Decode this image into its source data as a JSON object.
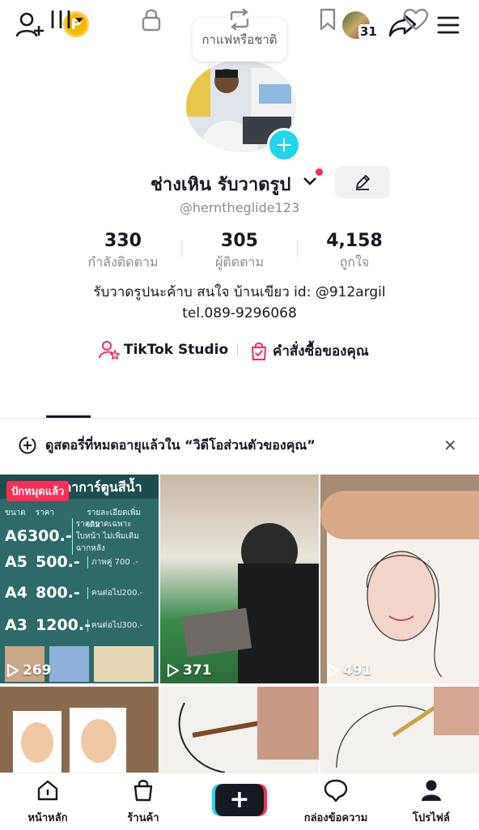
{
  "top_bar": {
    "coin_letter": "P",
    "notification_count": "31"
  },
  "tooltip": "กาแฟหรือชาติ",
  "profile": {
    "display_name": "ช่างเหิน รับวาดรูป",
    "username": "@herntheglide123",
    "stats": [
      {
        "value": "330",
        "label": "กำลังติดตาม"
      },
      {
        "value": "305",
        "label": "ผู้ติดตาม"
      },
      {
        "value": "4,158",
        "label": "ถูกใจ"
      }
    ],
    "bio_line1": "รับวาดรูปนะค้าบ สนใจ บ้านเขียว id: @912argil",
    "bio_line2": "tel.089-9296068",
    "link_studio": "TikTok Studio",
    "link_orders": "คำสั่งซื้อของคุณ"
  },
  "banner": {
    "text": "ดูสตอรี่ที่หมดอายุแล้วใน “วิดีโอส่วนตัวของคุณ”"
  },
  "videos": [
    {
      "views": "269",
      "pinned_label": "ปักหมุดแล้ว"
    },
    {
      "views": "371"
    },
    {
      "views": "491"
    }
  ],
  "price_card": {
    "heading": "ราคาการ์ตูนสีน้ำ",
    "col_size": "ขนาด",
    "col_price": "ราคา",
    "col_detail": "รายละเอียดเพิ่มเติม",
    "rows": [
      {
        "size": "A6",
        "price": "300.-",
        "note": "ราคาวาดเฉพาะใบหน้า ไม่เพิ่มเติมฉากหลัง"
      },
      {
        "size": "A5",
        "price": "500.-",
        "note": "ภาพคู่ 700 .-"
      },
      {
        "size": "A4",
        "price": "800.-",
        "note": "คนต่อไป200.-"
      },
      {
        "size": "A3",
        "price": "1200.-",
        "note": "คนต่อไป300.-"
      }
    ]
  },
  "bottom_nav": [
    {
      "label": "หน้าหลัก"
    },
    {
      "label": "ร้านค้า"
    },
    {
      "label": "กล่องข้อความ"
    },
    {
      "label": "โปรไฟล์"
    }
  ],
  "colors": {
    "accent": "#fe2c55",
    "cyan": "#20d5ec",
    "muted": "#8a8b91"
  }
}
